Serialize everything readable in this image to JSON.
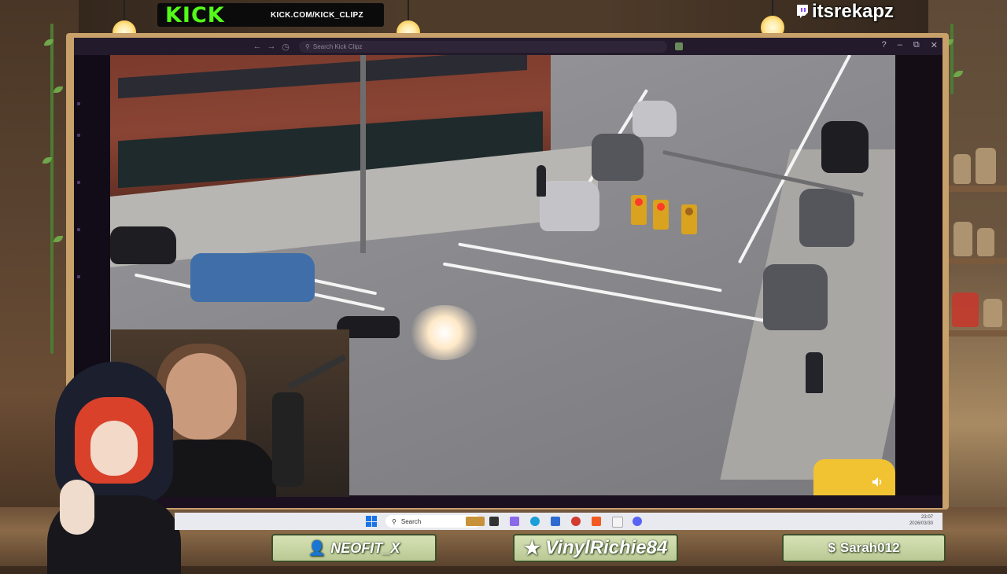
{
  "overlay": {
    "platform_logo": "KICK",
    "platform_url": "KICK.COM/KICK_CLIPZ",
    "streamer_handle": "itsrekapz"
  },
  "browser": {
    "search_placeholder": "Search Kick Clipz",
    "nav": [
      "back",
      "forward",
      "history"
    ],
    "window_controls": [
      "help",
      "minimize",
      "maximize",
      "close"
    ]
  },
  "taskbar": {
    "search_label": "Search",
    "time": "23:07",
    "date": "2026/03/30",
    "apps": [
      "widgets",
      "file-explorer",
      "copilot",
      "edge",
      "store",
      "chrome",
      "brave",
      "document",
      "discord"
    ]
  },
  "supporters": [
    {
      "name": "NEOFIT_X",
      "icon": "person-icon"
    },
    {
      "name": "VinylRichie84",
      "icon": "star-icon"
    },
    {
      "name": "Sarah012",
      "icon": "dollar-icon"
    }
  ],
  "colors": {
    "kick_green": "#53fc18",
    "badge_bg": "#c9d6a4",
    "frame": "#c8a06a"
  }
}
